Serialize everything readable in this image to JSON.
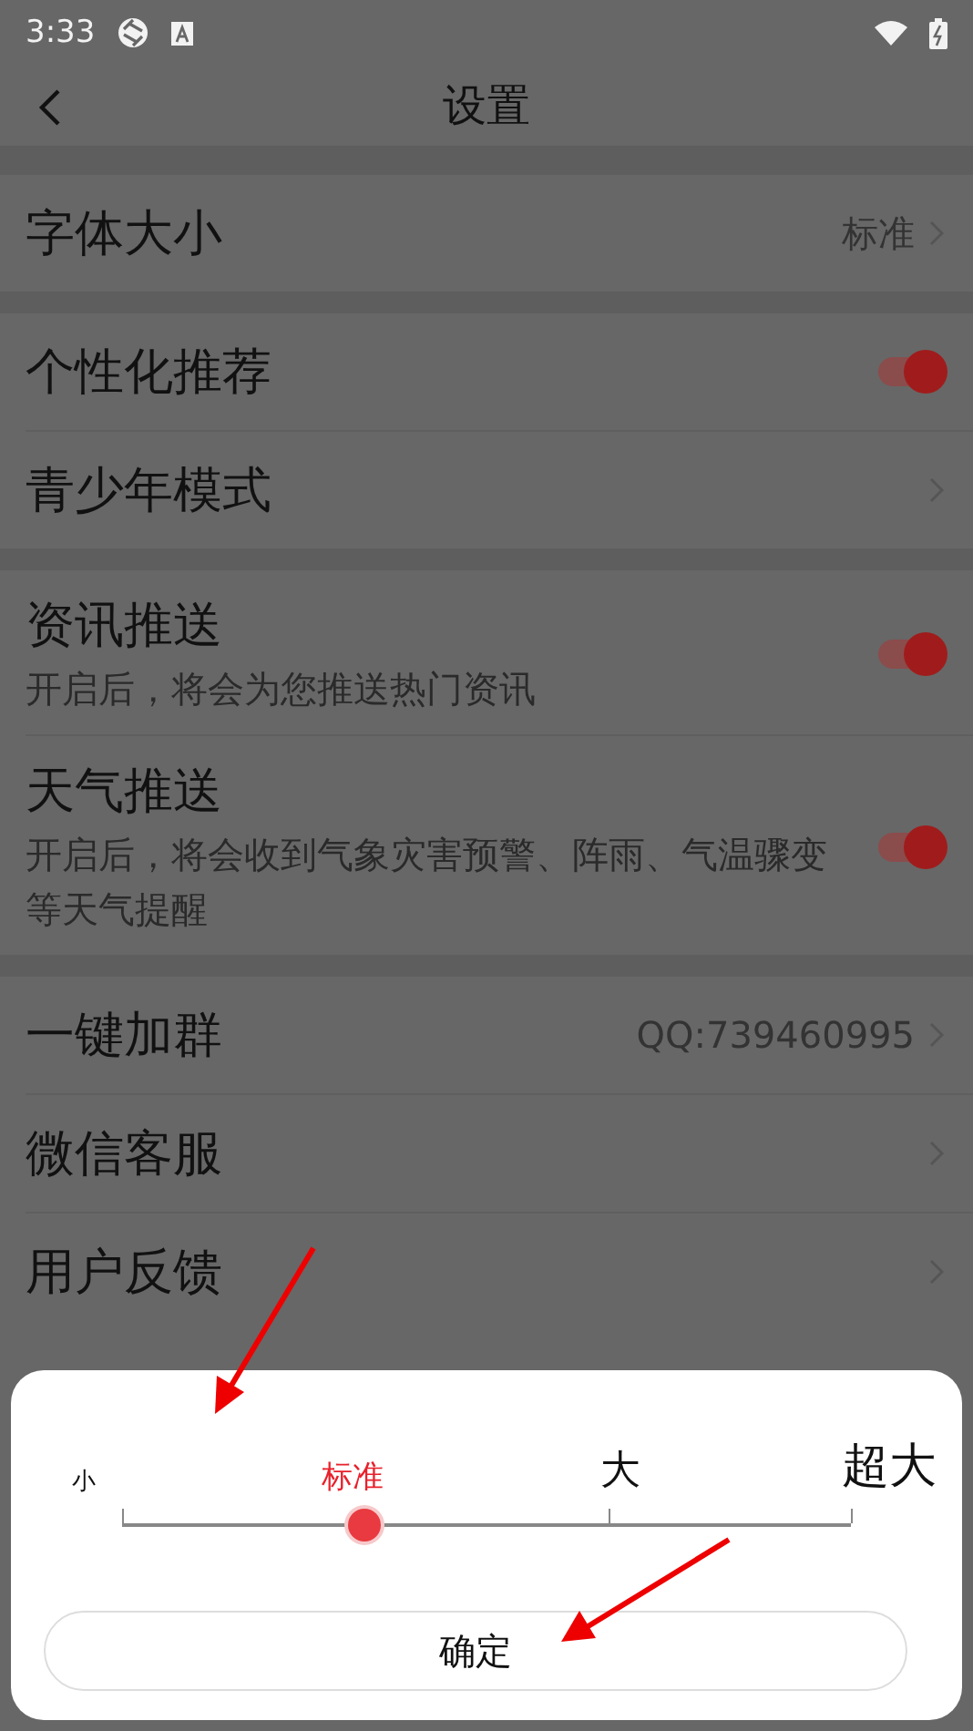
{
  "status_bar": {
    "time": "3:33"
  },
  "header": {
    "title": "设置"
  },
  "groups": [
    {
      "items": [
        {
          "kind": "value",
          "label": "字体大小",
          "value": "标准"
        }
      ]
    },
    {
      "items": [
        {
          "kind": "toggle",
          "label": "个性化推荐",
          "on": true
        },
        {
          "kind": "link",
          "label": "青少年模式"
        }
      ]
    },
    {
      "items": [
        {
          "kind": "toggle",
          "label": "资讯推送",
          "description": "开启后，将会为您推送热门资讯",
          "on": true
        },
        {
          "kind": "toggle",
          "label": "天气推送",
          "description": "开启后，将会收到气象灾害预警、阵雨、气温骤变等天气提醒",
          "on": true
        }
      ]
    },
    {
      "items": [
        {
          "kind": "value",
          "label": "一键加群",
          "value": "QQ:739460995"
        },
        {
          "kind": "link",
          "label": "微信客服"
        },
        {
          "kind": "link",
          "label": "用户反馈"
        }
      ]
    }
  ],
  "font_sheet": {
    "options": [
      {
        "label": "小",
        "selected": false
      },
      {
        "label": "标准",
        "selected": true
      },
      {
        "label": "大",
        "selected": false
      },
      {
        "label": "超大",
        "selected": false
      }
    ],
    "level": 0.333,
    "confirm": "确定"
  }
}
